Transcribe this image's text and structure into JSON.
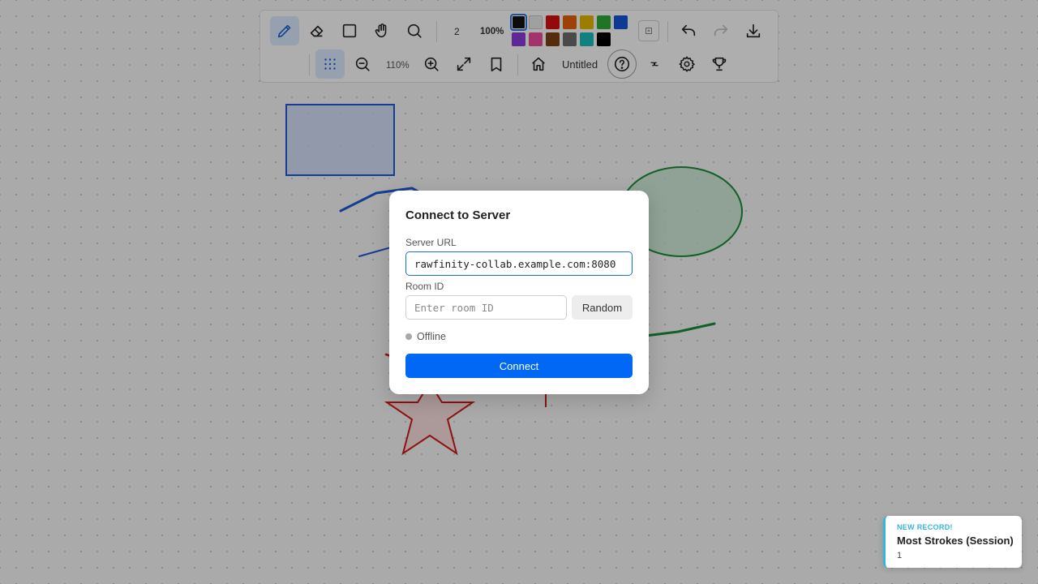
{
  "toolbar": {
    "brush_size": "2",
    "opacity": "100%",
    "zoom": "110%",
    "doc_title": "Untitled",
    "tools": [
      {
        "name": "pencil-tool",
        "icon": "pencil-icon",
        "active": true
      },
      {
        "name": "eraser-tool",
        "icon": "eraser-icon",
        "active": false
      },
      {
        "name": "rectangle-tool",
        "icon": "square-icon",
        "active": false
      },
      {
        "name": "pan-tool",
        "icon": "hand-icon",
        "active": false
      },
      {
        "name": "search-tool",
        "icon": "search-icon",
        "active": false
      }
    ],
    "palette": {
      "row1": [
        "#111111",
        "#e6e6e6",
        "#d10f0f",
        "#e15d0a",
        "#e0b300",
        "#2ea836",
        "#1554d4"
      ],
      "row2": [
        "#8a3ad4",
        "#e84a9a",
        "#7a3f12",
        "#6b6b6b",
        "#17b8b8",
        "#000000"
      ],
      "selected": "#111111"
    }
  },
  "modal": {
    "title": "Connect to Server",
    "server_label": "Server URL",
    "server_value": "rawfinity-collab.example.com:8080",
    "room_label": "Room ID",
    "room_placeholder": "Enter room ID",
    "random_label": "Random",
    "status": "Offline",
    "connect_label": "Connect"
  },
  "toast": {
    "kicker": "NEW RECORD!",
    "title": "Most Strokes (Session)",
    "value": "1"
  },
  "colors": {
    "accent": "#0068f5",
    "toast_accent": "#34b6dd"
  }
}
